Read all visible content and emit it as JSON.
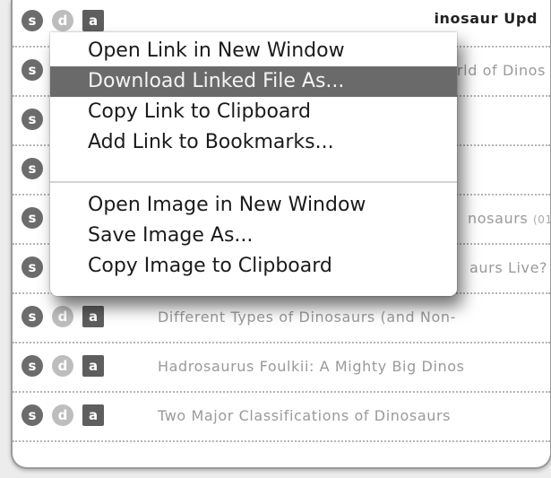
{
  "rows": [
    {
      "title": "Where Did The ... Dinosaur Upd",
      "bold": true
    },
    {
      "title": "rld of Dinos"
    },
    {
      "title": ""
    },
    {
      "title": ""
    },
    {
      "title": "nosaurs",
      "small": "(01"
    },
    {
      "title": "aurs Live?"
    },
    {
      "title": "Different Types of Dinosaurs (and Non-"
    },
    {
      "title": "Hadrosaurus Foulkii: A Mighty Big Dinos"
    },
    {
      "title": "Two Major Classifications of Dinosaurs"
    }
  ],
  "row_buttons": {
    "s": "s",
    "d": "d",
    "a": "a"
  },
  "context_menu": {
    "items": [
      {
        "label": "Open Link in New Window"
      },
      {
        "label": "Download Linked File As..."
      },
      {
        "label": "Copy Link to Clipboard"
      },
      {
        "label": "Add Link to Bookmarks..."
      },
      {
        "label": "Open Image in New Window"
      },
      {
        "label": "Save Image As..."
      },
      {
        "label": "Copy Image to Clipboard"
      }
    ],
    "highlighted_index": 1
  },
  "colors": {
    "highlight": "#6a6a6a",
    "button_s": "#6c6c6c",
    "button_d": "#bdbdbd",
    "button_a": "#5e5e5e"
  }
}
